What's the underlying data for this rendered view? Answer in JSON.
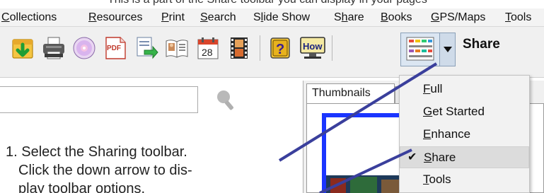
{
  "top_caption": "This is a part of the Share toolbar you can display in your pages",
  "menubar": {
    "items": [
      {
        "before": "",
        "mnemonic": "C",
        "after": "ollections"
      },
      {
        "before": "",
        "mnemonic": "R",
        "after": "esources"
      },
      {
        "before": "",
        "mnemonic": "P",
        "after": "rint"
      },
      {
        "before": "",
        "mnemonic": "S",
        "after": "earch"
      },
      {
        "before": "S",
        "mnemonic": "l",
        "after": "ide Show"
      },
      {
        "before": "S",
        "mnemonic": "h",
        "after": "are"
      },
      {
        "before": "",
        "mnemonic": "B",
        "after": "ooks"
      },
      {
        "before": "",
        "mnemonic": "G",
        "after": "PS/Maps"
      },
      {
        "before": "",
        "mnemonic": "T",
        "after": "ools"
      }
    ]
  },
  "toolbar": {
    "title": "Share",
    "calendar_day": "28",
    "pdf_label": "PDF",
    "help_label": "?",
    "how_label": "How",
    "buttons": [
      "export-icon",
      "printer-icon",
      "disc-icon",
      "pdf-icon",
      "email-icon",
      "book-icon",
      "calendar-icon",
      "film-icon",
      "help-icon",
      "how-to-icon",
      "toolbar-selector-icon"
    ]
  },
  "search": {
    "value": "",
    "icon": "magnifier-icon"
  },
  "panel": {
    "tab_label": "Thumbnails"
  },
  "dropdown": {
    "items": [
      {
        "mnemonic": "F",
        "rest": "ull",
        "checked": false,
        "selected": false
      },
      {
        "mnemonic": "G",
        "rest": "et Started",
        "checked": false,
        "selected": false
      },
      {
        "mnemonic": "E",
        "rest": "nhance",
        "checked": false,
        "selected": false
      },
      {
        "mnemonic": "S",
        "rest": "hare",
        "checked": true,
        "selected": true
      },
      {
        "mnemonic": "T",
        "rest": "ools",
        "checked": false,
        "selected": false
      }
    ],
    "check_glyph": "✔"
  },
  "annotation": {
    "line1": "1. Select the Sharing toolbar.",
    "line2": "Click the down arrow to dis-",
    "line3": "play toolbar options."
  },
  "colors": {
    "pointer_line": "#3a3f9c",
    "thumb_border": "#1a35ff"
  }
}
